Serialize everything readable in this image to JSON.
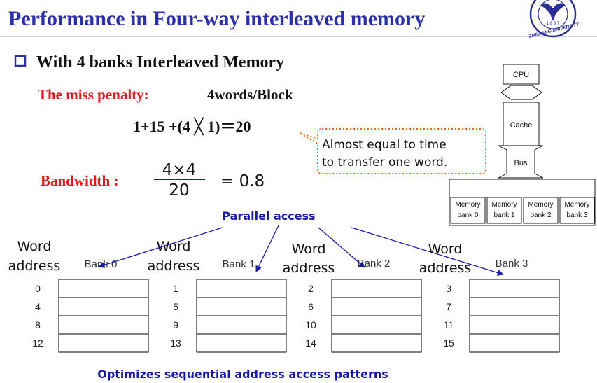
{
  "title": "Performance in Four-way interleaved memory",
  "logo": {
    "top_text": "1 8 9 7",
    "bottom_text": "ZHEJIANG UNIVERSITY",
    "color": "#2b2f93"
  },
  "bullet": "With 4 banks Interleaved Memory",
  "miss_penalty": {
    "label": "The miss penalty:",
    "value": "4words/Block",
    "formula": "1+15 +(4 ╳ 1)＝20"
  },
  "callout": {
    "line1": "Almost equal to time",
    "line2": "to transfer one word."
  },
  "bandwidth": {
    "label": "Bandwidth :",
    "numerator": "4×4",
    "denominator": "20",
    "result": "= 0.8"
  },
  "parallel_access": "Parallel access",
  "hierarchy": {
    "cpu": "CPU",
    "cache": "Cache",
    "bus": "Bus",
    "banks": [
      {
        "line1": "Memory",
        "line2": "bank 0"
      },
      {
        "line1": "Memory",
        "line2": "bank 1"
      },
      {
        "line1": "Memory",
        "line2": "bank 2"
      },
      {
        "line1": "Memory",
        "line2": "bank 3"
      }
    ]
  },
  "word_label": {
    "line1": "Word",
    "line2": "address"
  },
  "banks": [
    {
      "name": "Bank 0",
      "addresses": [
        "0",
        "4",
        "8",
        "12"
      ]
    },
    {
      "name": "Bank 1",
      "addresses": [
        "1",
        "5",
        "9",
        "13"
      ]
    },
    {
      "name": "Bank 2",
      "addresses": [
        "2",
        "6",
        "10",
        "14"
      ]
    },
    {
      "name": "Bank 3",
      "addresses": [
        "3",
        "7",
        "11",
        "15"
      ]
    }
  ],
  "footer": "Optimizes sequential address access patterns",
  "colors": {
    "title": "#2b2fa8",
    "red": "#e8141c",
    "blue": "#1a1aa6",
    "callout_border": "#e66a1a"
  }
}
